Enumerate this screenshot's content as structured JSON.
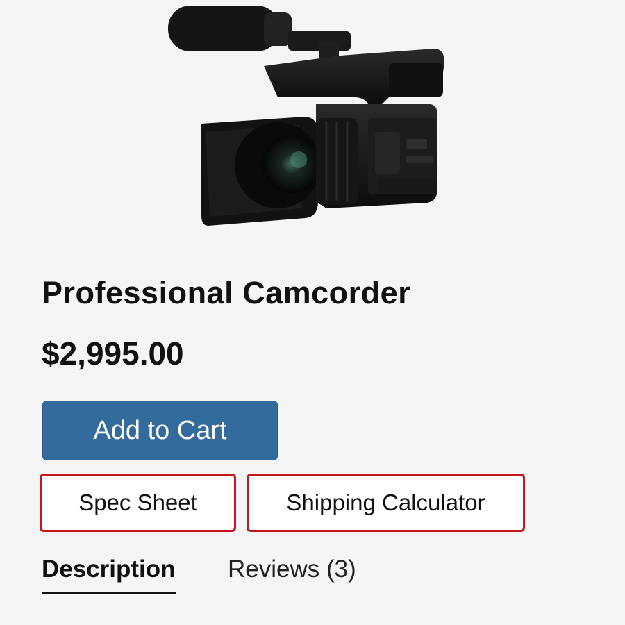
{
  "product": {
    "title": "Professional Camcorder",
    "price": "$2,995.00",
    "image_icon": "camcorder-icon"
  },
  "actions": {
    "add_to_cart": "Add to Cart",
    "spec_sheet": "Spec Sheet",
    "shipping_calculator": "Shipping Calculator"
  },
  "tabs": [
    {
      "label": "Description",
      "active": true
    },
    {
      "label": "Reviews (3)",
      "active": false
    }
  ],
  "colors": {
    "primary_button": "#336b9c",
    "outline_border": "#c4161c",
    "background": "#f5f5f5"
  }
}
